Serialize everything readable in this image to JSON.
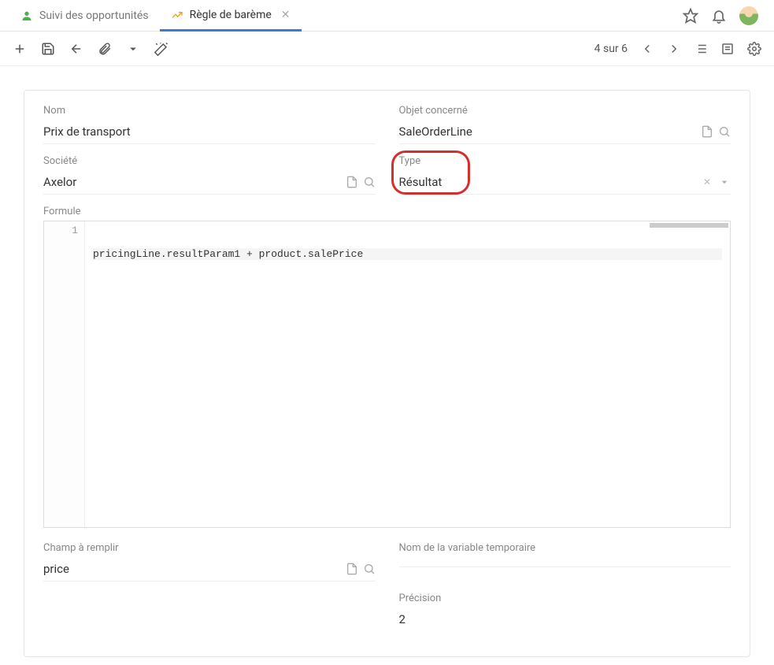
{
  "tabs": [
    {
      "label": "Suivi des opportunités",
      "active": false,
      "icon": "person"
    },
    {
      "label": "Règle de barème",
      "active": true,
      "icon": "chart"
    }
  ],
  "toolbar": {
    "page_info": "4 sur 6"
  },
  "form": {
    "nom": {
      "label": "Nom",
      "value": "Prix de transport"
    },
    "objet": {
      "label": "Objet concerné",
      "value": "SaleOrderLine"
    },
    "societe": {
      "label": "Société",
      "value": "Axelor"
    },
    "type": {
      "label": "Type",
      "value": "Résultat"
    },
    "formule": {
      "label": "Formule",
      "line_number": "1",
      "code": "pricingLine.resultParam1 + product.salePrice"
    },
    "champ": {
      "label": "Champ à remplir",
      "value": "price"
    },
    "var_temp": {
      "label": "Nom de la variable temporaire",
      "value": ""
    },
    "precision": {
      "label": "Précision",
      "value": "2"
    }
  }
}
